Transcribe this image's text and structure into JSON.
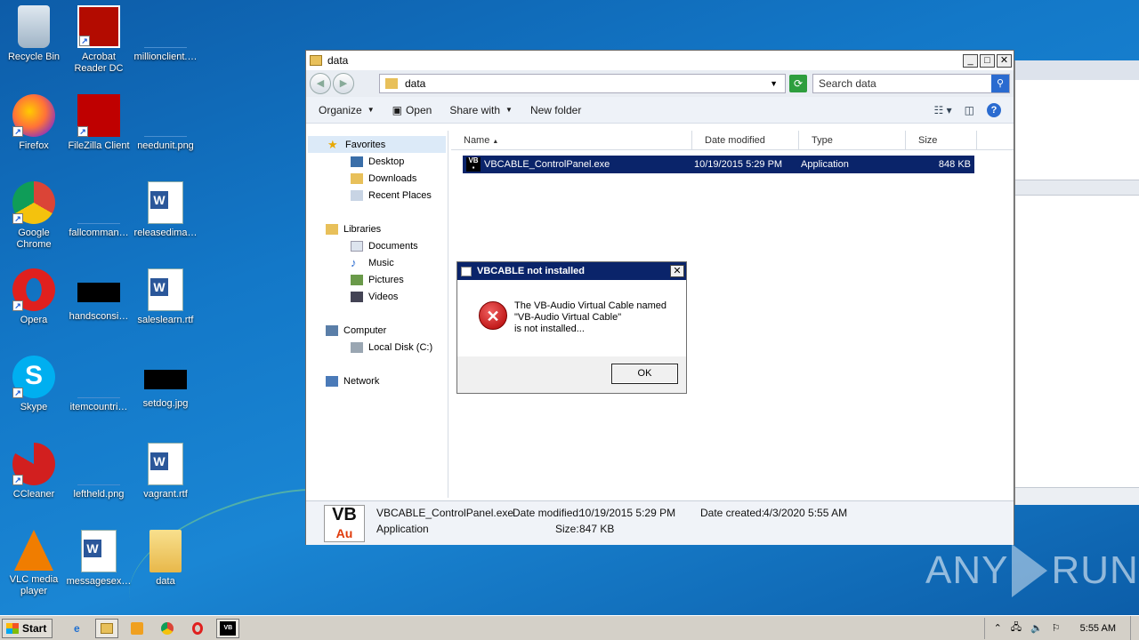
{
  "desktop": {
    "icons": [
      {
        "label": "Recycle Bin",
        "icon": "recycle-bin-icon"
      },
      {
        "label": "Acrobat Reader DC",
        "icon": "acrobat-icon"
      },
      {
        "label": "millionclient.…",
        "icon": "file-icon"
      },
      {
        "label": "Firefox",
        "icon": "firefox-icon"
      },
      {
        "label": "FileZilla Client",
        "icon": "filezilla-icon"
      },
      {
        "label": "needunit.png",
        "icon": "file-icon"
      },
      {
        "label": "Google Chrome",
        "icon": "chrome-icon"
      },
      {
        "label": "fallcomman…",
        "icon": "file-icon"
      },
      {
        "label": "releasedima…",
        "icon": "word-doc-icon"
      },
      {
        "label": "Opera",
        "icon": "opera-icon"
      },
      {
        "label": "handsconsi…",
        "icon": "image-file-icon"
      },
      {
        "label": "saleslearn.rtf",
        "icon": "word-doc-icon"
      },
      {
        "label": "Skype",
        "icon": "skype-icon"
      },
      {
        "label": "itemcountri…",
        "icon": "file-icon"
      },
      {
        "label": "setdog.jpg",
        "icon": "image-file-icon"
      },
      {
        "label": "CCleaner",
        "icon": "ccleaner-icon"
      },
      {
        "label": "leftheld.png",
        "icon": "file-icon"
      },
      {
        "label": "vagrant.rtf",
        "icon": "word-doc-icon"
      },
      {
        "label": "VLC media player",
        "icon": "vlc-icon"
      },
      {
        "label": "messagesex…",
        "icon": "word-doc-icon"
      },
      {
        "label": "data",
        "icon": "folder-icon"
      }
    ]
  },
  "explorer": {
    "title": "data",
    "address": "data",
    "search_placeholder": "Search data",
    "toolbar": {
      "organize": "Organize",
      "open": "Open",
      "share_with": "Share with",
      "new_folder": "New folder"
    },
    "nav": {
      "favorites": "Favorites",
      "desktop": "Desktop",
      "downloads": "Downloads",
      "recent_places": "Recent Places",
      "libraries": "Libraries",
      "documents": "Documents",
      "music": "Music",
      "pictures": "Pictures",
      "videos": "Videos",
      "computer": "Computer",
      "local_disk": "Local Disk (C:)",
      "network": "Network"
    },
    "columns": {
      "name": "Name",
      "date_modified": "Date modified",
      "type": "Type",
      "size": "Size"
    },
    "files": [
      {
        "name": "VBCABLE_ControlPanel.exe",
        "date_modified": "10/19/2015 5:29 PM",
        "type": "Application",
        "size": "848 KB"
      }
    ],
    "details": {
      "filename": "VBCABLE_ControlPanel.exe",
      "type": "Application",
      "date_modified_label": "Date modified:",
      "date_modified": "10/19/2015 5:29 PM",
      "size_label": "Size:",
      "size": "847 KB",
      "date_created_label": "Date created:",
      "date_created": "4/3/2020 5:55 AM"
    }
  },
  "dialog": {
    "title": "VBCABLE not installed",
    "message": "The VB-Audio Virtual Cable named\n\"VB-Audio Virtual Cable\"\nis not installed...",
    "ok": "OK"
  },
  "taskbar": {
    "start": "Start",
    "clock": "5:55 AM"
  },
  "watermark": {
    "left": "ANY",
    "right": "RUN"
  },
  "colors": {
    "selection": "#0a246a",
    "desktop": "#1378c8",
    "error": "#c00000"
  }
}
